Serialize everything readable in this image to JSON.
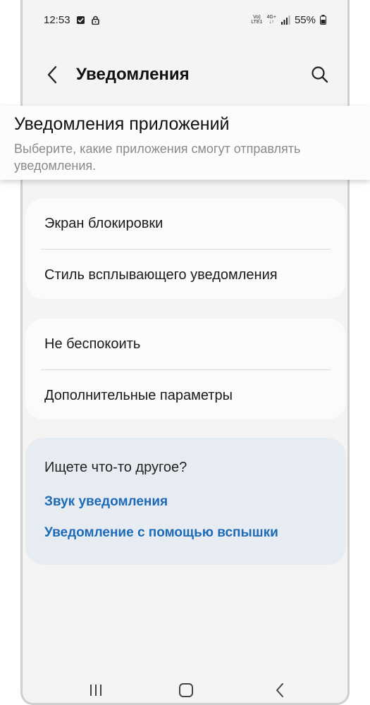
{
  "status_bar": {
    "time": "12:53",
    "volte_top": "Vo)",
    "volte_bottom": "LTE1",
    "network_type": "4G+",
    "battery": "55%"
  },
  "app_bar": {
    "title": "Уведомления"
  },
  "app_notifications": {
    "title": "Уведомления приложений",
    "subtitle": "Выберите, какие приложения смогут отправлять уведомления."
  },
  "groups": [
    {
      "items": [
        "Экран блокировки",
        "Стиль всплывающего уведомления"
      ]
    },
    {
      "items": [
        "Не беспокоить",
        "Дополнительные параметры"
      ]
    }
  ],
  "suggestions": {
    "title": "Ищете что-то другое?",
    "links": [
      "Звук уведомления",
      "Уведомление с помощью вспышки"
    ]
  },
  "colors": {
    "link": "#1c6ab8",
    "background": "#f4f4f4",
    "suggest_background": "#e7ecf2"
  },
  "icons": {
    "back": "chevron-left-icon",
    "search": "search-icon",
    "recents": "recents-icon",
    "home": "home-icon",
    "nav_back": "nav-back-icon"
  }
}
